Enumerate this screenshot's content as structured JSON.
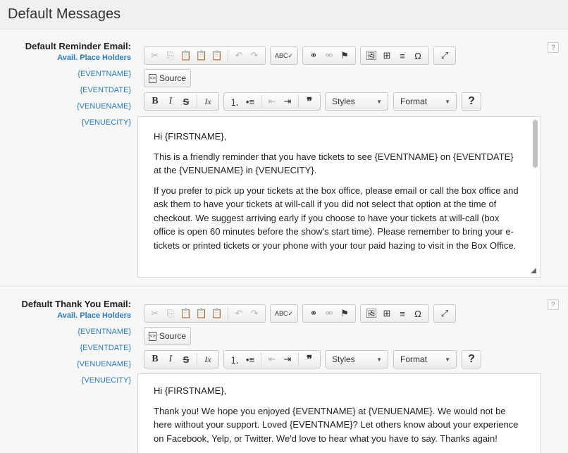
{
  "header": {
    "title": "Default Messages"
  },
  "placeholders_heading": "Avail. Place Holders",
  "placeholders": [
    "{EVENTNAME}",
    "{EVENTDATE}",
    "{VENUENAME}",
    "{VENUECITY}"
  ],
  "help_label": "?",
  "toolbar": {
    "source_label": "Source",
    "styles_label": "Styles",
    "format_label": "Format",
    "help_label": "?",
    "icons": {
      "cut": "✂",
      "copy": "⎘",
      "paste": "📋",
      "paste_text": "📋",
      "paste_word": "📋",
      "undo": "↶",
      "redo": "↷",
      "spell": "ABC✓",
      "link": "⚭",
      "unlink": "⚮",
      "anchor": "⚑",
      "image": "🖼",
      "table": "⊞",
      "hr": "≡",
      "special_char": "Ω",
      "maximize": "⤢",
      "bold": "B",
      "italic": "I",
      "strike": "S",
      "remove_format": "Ix",
      "numbered_list": "⒈",
      "bulleted_list": "•≡",
      "outdent": "⇤",
      "indent": "⇥",
      "blockquote": "❞",
      "dropdown_arrow": "▼"
    }
  },
  "reminder": {
    "label": "Default Reminder Email:",
    "paragraphs": [
      "Hi {FIRSTNAME},",
      "This is a friendly reminder that you have tickets to see {EVENTNAME} on {EVENTDATE} at the {VENUENAME} in {VENUECITY}.",
      "If you prefer to pick up your tickets at the box office, please email or call the box office and ask them to have your tickets at will-call if you did not select that option at the time of checkout.  We suggest arriving early if you choose to have your tickets at will-call (box office is open 60 minutes before the show's start time). Please remember to bring your e-tickets or printed tickets or your phone with your tour paid hazing to visit in the Box Office."
    ]
  },
  "thankyou": {
    "label": "Default Thank You Email:",
    "paragraphs": [
      "Hi {FIRSTNAME},",
      "Thank you! We hope you enjoyed {EVENTNAME} at {VENUENAME}. We would not be here without your support. Loved {EVENTNAME}? Let others know about your experience on Facebook, Yelp, or Twitter. We'd love to hear what you have to say. Thanks again!"
    ]
  }
}
